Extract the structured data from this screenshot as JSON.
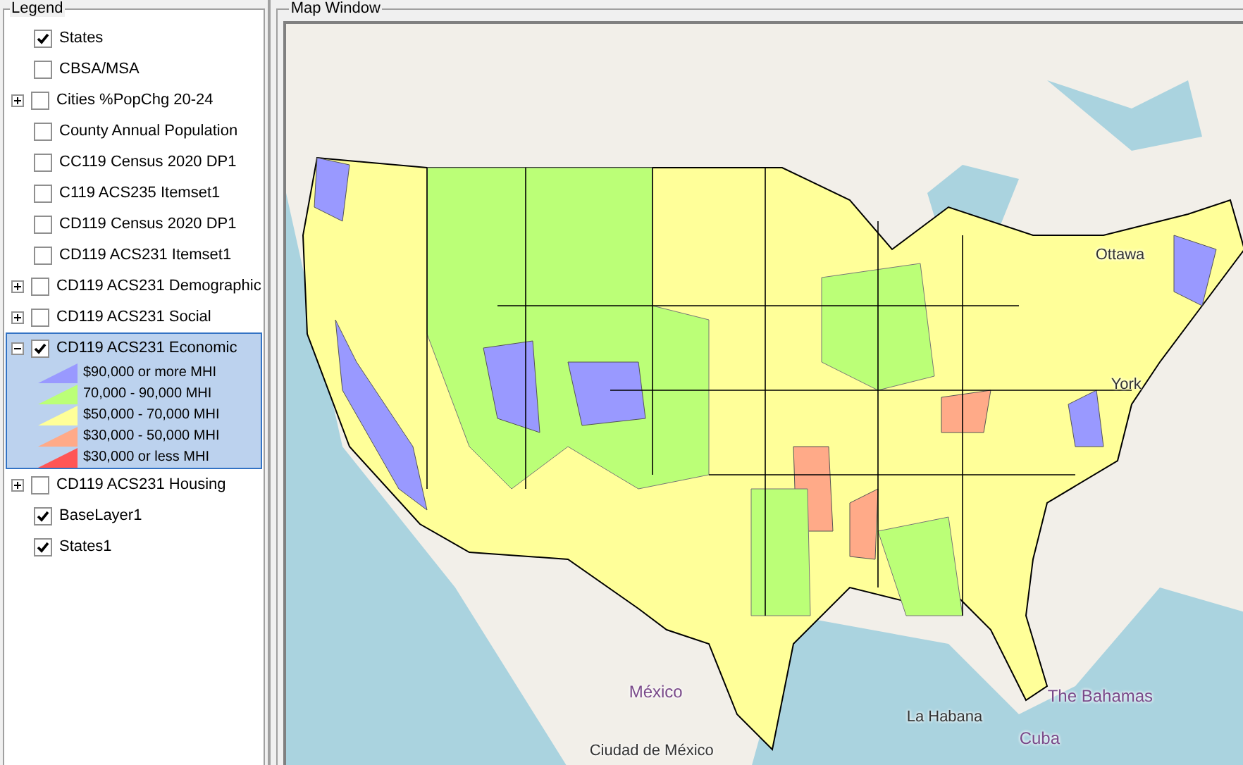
{
  "legend": {
    "title": "Legend",
    "layers": [
      {
        "label": "States",
        "checked": true,
        "selected": false
      },
      {
        "label": "CBSA/MSA",
        "checked": false,
        "selected": false
      },
      {
        "label": "Cities %PopChg 20-24",
        "checked": false,
        "expanded": false,
        "selected": false
      },
      {
        "label": "County Annual Population",
        "checked": false,
        "selected": false
      },
      {
        "label": "CC119 Census 2020 DP1",
        "checked": false,
        "selected": false
      },
      {
        "label": "C119 ACS235 Itemset1",
        "checked": false,
        "selected": false
      },
      {
        "label": "CD119 Census 2020 DP1",
        "checked": false,
        "selected": false
      },
      {
        "label": "CD119 ACS231 Itemset1",
        "checked": false,
        "selected": false
      },
      {
        "label": "CD119 ACS231 Demographic",
        "checked": false,
        "expanded": false,
        "selected": false
      },
      {
        "label": "CD119 ACS231 Social",
        "checked": false,
        "expanded": false,
        "selected": false
      },
      {
        "label": "CD119 ACS231 Economic",
        "checked": true,
        "expanded": true,
        "selected": true,
        "classes": [
          {
            "label": "$90,000 or more MHI",
            "color": "#9999ff"
          },
          {
            "label": "70,000 - 90,000 MHI",
            "color": "#bbff77"
          },
          {
            "label": "$50,000 - 70,000 MHI",
            "color": "#ffff99"
          },
          {
            "label": "$30,000 - 50,000 MHI",
            "color": "#ffaa88"
          },
          {
            "label": "$30,000 or less MHI",
            "color": "#ff5555"
          }
        ]
      },
      {
        "label": "CD119 ACS231 Housing",
        "checked": false,
        "expanded": false,
        "selected": false
      },
      {
        "label": "BaseLayer1",
        "checked": true,
        "selected": false
      },
      {
        "label": "States1",
        "checked": true,
        "selected": false
      }
    ]
  },
  "map": {
    "title": "Map Window",
    "labels": [
      {
        "text": "Ottawa",
        "kind": "city"
      },
      {
        "text": "York",
        "kind": "city"
      },
      {
        "text": "México",
        "kind": "country"
      },
      {
        "text": "The Bahamas",
        "kind": "country"
      },
      {
        "text": "La Habana",
        "kind": "city"
      },
      {
        "text": "Cuba",
        "kind": "country"
      },
      {
        "text": "Ciudad de México",
        "kind": "city"
      }
    ]
  }
}
